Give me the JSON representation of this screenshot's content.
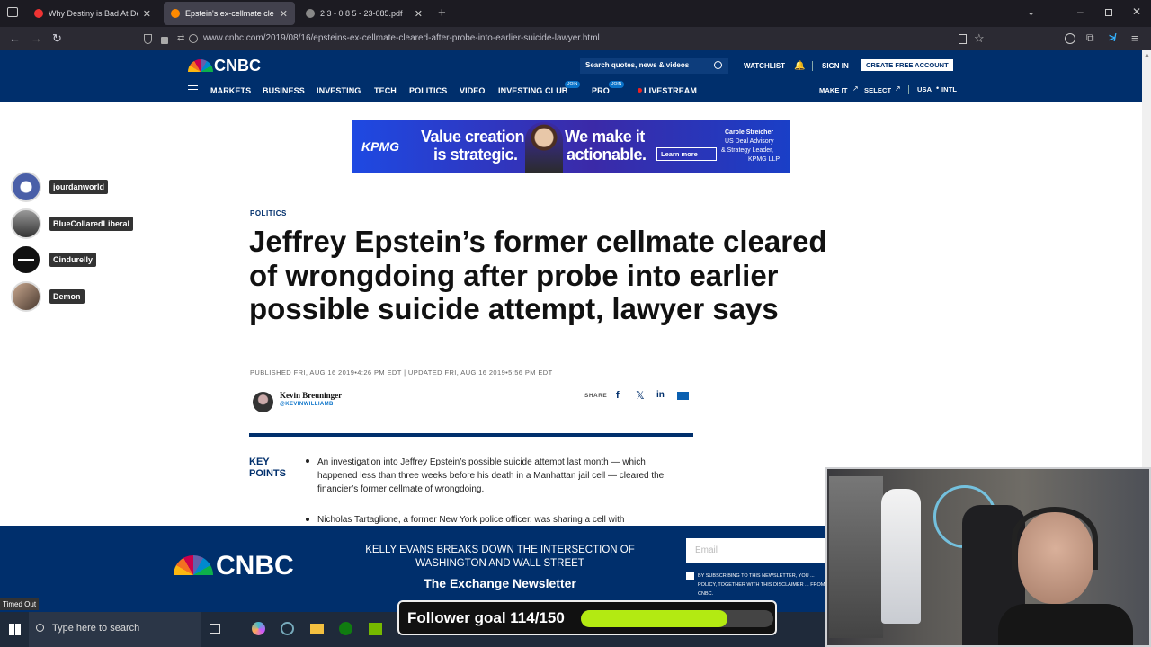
{
  "browser": {
    "tabs": [
      {
        "label": "Why Destiny is Bad At Debating",
        "active": false
      },
      {
        "label": "Epstein's ex-cellmate cleared af",
        "active": true
      },
      {
        "label": "2 3 - 0 8 5 - 23-085.pdf",
        "active": false
      }
    ],
    "url": "www.cnbc.com/2019/08/16/epsteins-ex-cellmate-cleared-after-probe-into-earlier-suicide-lawyer.html"
  },
  "cnbc": {
    "logo": "CNBC",
    "search_placeholder": "Search quotes, news & videos",
    "watchlist": "WATCHLIST",
    "sign_in": "SIGN IN",
    "create_account": "CREATE FREE ACCOUNT",
    "nav": [
      "MARKETS",
      "BUSINESS",
      "INVESTING",
      "TECH",
      "POLITICS",
      "VIDEO",
      "INVESTING CLUB",
      "PRO",
      "LIVESTREAM"
    ],
    "join_badge": "JOIN",
    "make_it": "MAKE IT",
    "select": "SELECT",
    "usa": "USA",
    "intl": "INTL"
  },
  "ad": {
    "brand": "KPMG",
    "line1": "Value creation",
    "line2": "is strategic.",
    "line3": "We make it",
    "line4": "actionable.",
    "cta": "Learn more",
    "person": "Carole Streicher",
    "role1": "US Deal Advisory",
    "role2": "& Strategy Leader,",
    "role3": "KPMG LLP"
  },
  "chat_users": [
    {
      "name": "jourdanworld",
      "color": "#4a5fa8"
    },
    {
      "name": "BlueCollaredLiberal",
      "color": "#6b6b6b"
    },
    {
      "name": "Cindurelly",
      "color": "#111111"
    },
    {
      "name": "Demon",
      "color": "#8a6d5a"
    }
  ],
  "article": {
    "section": "POLITICS",
    "headline": "Jeffrey Epstein’s former cellmate cleared of wrongdoing after probe into earlier possible suicide attempt, lawyer says",
    "dates": "PUBLISHED FRI, AUG 16 2019•4:26 PM EDT | UPDATED FRI, AUG 16 2019•5:56 PM EDT",
    "author": "Kevin Breuninger",
    "handle": "@KEVINWILLIAMB",
    "share": "SHARE",
    "key_points_label_1": "KEY",
    "key_points_label_2": "POINTS",
    "key_points": [
      "An investigation into Jeffrey Epstein’s possible suicide attempt last month — which happened less than three weeks before his death in a Manhattan jail cell — cleared the financier’s former cellmate of wrongdoing.",
      "Nicholas Tartaglione, a former New York police officer, was sharing a cell with"
    ]
  },
  "newsletter": {
    "logo": "CNBC",
    "headline": "KELLY EVANS BREAKS DOWN THE INTERSECTION OF WASHINGTON AND WALL STREET",
    "title": "The Exchange Newsletter",
    "email_placeholder": "Email",
    "terms": "BY SUBSCRIBING TO THIS NEWSLETTER, YOU ... POLICY, TOGETHER WITH THIS DISCLAIMER ... FROM CNBC."
  },
  "overlay": {
    "timed_out": "Timed Out",
    "follower_goal_label": "Follower goal 114/150",
    "follower_current": 114,
    "follower_target": 150
  },
  "taskbar": {
    "search_placeholder": "Type here to search"
  },
  "colors": {
    "cnbc_navy": "#002f6c",
    "goal_fill": "#b3ea12"
  }
}
